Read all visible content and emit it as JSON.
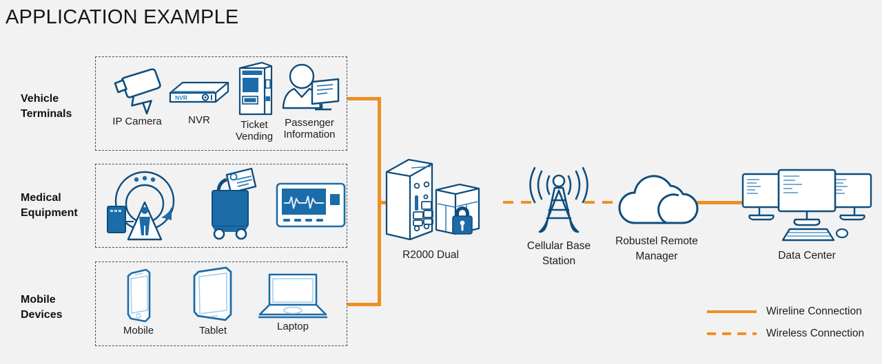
{
  "page": {
    "title": "APPLICATION EXAMPLE",
    "background_color": "#f2f2f2",
    "accent_orange": "#ec9025",
    "icon_blue_dark": "#0e4d7d",
    "icon_blue_fill": "#1b6ca8"
  },
  "groups": [
    {
      "name": "vehicle-terminals",
      "label": "Vehicle\nTerminals",
      "items": [
        {
          "name": "ip-camera",
          "caption": "IP Camera",
          "icon": "ip-camera-icon"
        },
        {
          "name": "nvr",
          "caption": "NVR",
          "icon": "nvr-icon"
        },
        {
          "name": "ticket-vending",
          "caption": "Ticket\nVending",
          "icon": "ticket-vending-machine-icon"
        },
        {
          "name": "passenger-information",
          "caption": "Passenger\nInformation",
          "icon": "passenger-information-icon"
        }
      ]
    },
    {
      "name": "medical-equipment",
      "label": "Medical\nEquipment",
      "items": [
        {
          "name": "ct-scanner",
          "caption": "",
          "icon": "ct-scanner-icon"
        },
        {
          "name": "medical-cart",
          "caption": "",
          "icon": "medical-cart-icon"
        },
        {
          "name": "patient-monitor",
          "caption": "",
          "icon": "ecg-patient-monitor-icon"
        }
      ]
    },
    {
      "name": "mobile-devices",
      "label": "Mobile\nDevices",
      "items": [
        {
          "name": "mobile",
          "caption": "Mobile",
          "icon": "smartphone-icon"
        },
        {
          "name": "tablet",
          "caption": "Tablet",
          "icon": "tablet-icon"
        },
        {
          "name": "laptop",
          "caption": "Laptop",
          "icon": "laptop-icon"
        }
      ]
    }
  ],
  "nodes": [
    {
      "name": "router",
      "label": "R2000 Dual",
      "icon": "router-device-icon"
    },
    {
      "name": "cellular-base-station",
      "label": "Cellular Base\nStation",
      "icon": "cell-tower-icon"
    },
    {
      "name": "remote-manager",
      "label": "Robustel Remote\nManager",
      "icon": "cloud-icon"
    },
    {
      "name": "data-center",
      "label": "Data Center",
      "icon": "monitors-icon"
    }
  ],
  "legend": {
    "items": [
      {
        "name": "wireline",
        "label": "Wireline Connection",
        "style": "solid",
        "color": "#ec9025"
      },
      {
        "name": "wireless",
        "label": "Wireless Connection",
        "style": "dashed",
        "color": "#ec9025"
      }
    ]
  }
}
